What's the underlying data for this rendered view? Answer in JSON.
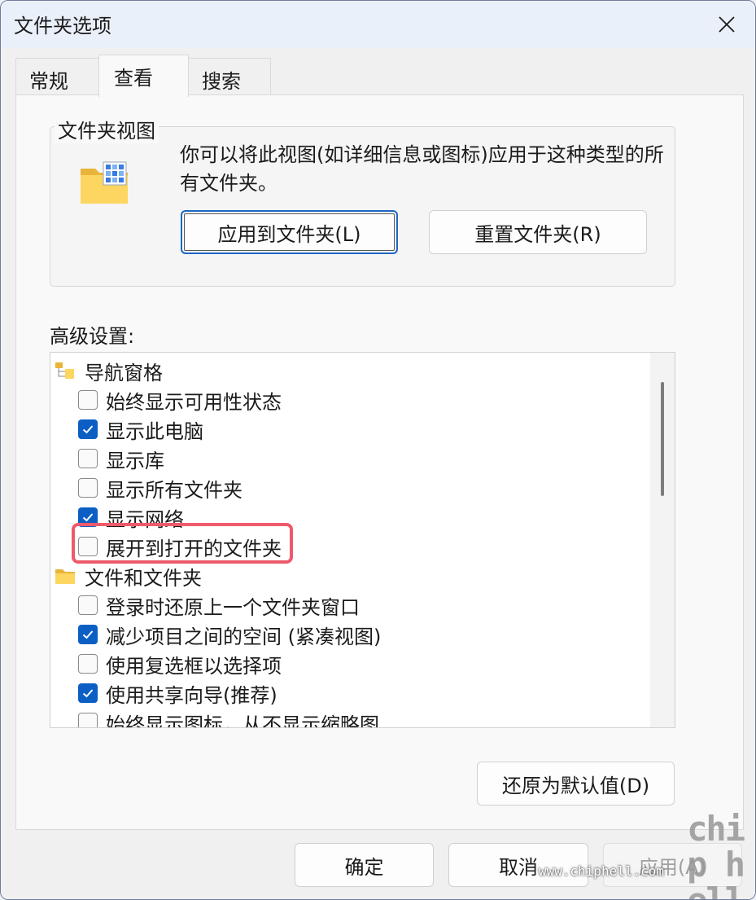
{
  "window": {
    "title": "文件夹选项"
  },
  "tabs": [
    {
      "label": "常规"
    },
    {
      "label": "查看"
    },
    {
      "label": "搜索"
    }
  ],
  "active_tab": "查看",
  "folder_views": {
    "legend": "文件夹视图",
    "description": "你可以将此视图(如详细信息或图标)应用于这种类型的所有文件夹。",
    "apply_button": "应用到文件夹(L)",
    "reset_button": "重置文件夹(R)"
  },
  "advanced": {
    "label": "高级设置:",
    "items": [
      {
        "type": "category",
        "label": "导航窗格",
        "icon": "nav-pane-icon"
      },
      {
        "type": "checkbox",
        "label": "始终显示可用性状态",
        "checked": false
      },
      {
        "type": "checkbox",
        "label": "显示此电脑",
        "checked": true
      },
      {
        "type": "checkbox",
        "label": "显示库",
        "checked": false
      },
      {
        "type": "checkbox",
        "label": "显示所有文件夹",
        "checked": false
      },
      {
        "type": "checkbox",
        "label": "显示网络",
        "checked": true
      },
      {
        "type": "checkbox",
        "label": "展开到打开的文件夹",
        "checked": false
      },
      {
        "type": "category",
        "label": "文件和文件夹",
        "icon": "folder-icon"
      },
      {
        "type": "checkbox",
        "label": "登录时还原上一个文件夹窗口",
        "checked": false
      },
      {
        "type": "checkbox",
        "label": "减少项目之间的空间 (紧凑视图)",
        "checked": true
      },
      {
        "type": "checkbox",
        "label": "使用复选框以选择项",
        "checked": false
      },
      {
        "type": "checkbox",
        "label": "使用共享向导(推荐)",
        "checked": true
      },
      {
        "type": "checkbox",
        "label": "始终显示图标，从不显示缩略图",
        "checked": false
      }
    ],
    "restore_defaults_button": "还原为默认值(D)"
  },
  "footer": {
    "ok_button": "确定",
    "cancel_button": "取消",
    "apply_button": "应用(A)"
  },
  "watermark": {
    "logo": "chip hell",
    "url": "www.chiphell.com"
  },
  "colors": {
    "accent": "#0b5fc4",
    "highlight": "#ee5a6b"
  }
}
